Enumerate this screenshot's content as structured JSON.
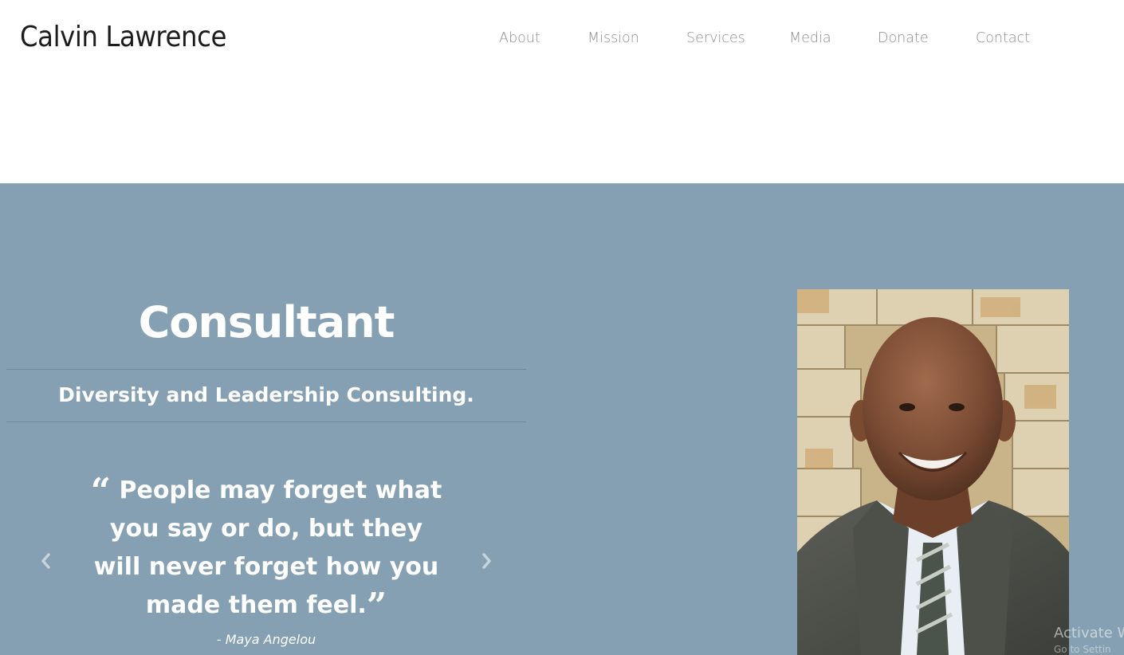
{
  "header": {
    "site_title": "Calvin Lawrence",
    "nav": [
      "About",
      "Mission",
      "Services",
      "Media",
      "Donate",
      "Contact"
    ]
  },
  "hero": {
    "title": "Consultant",
    "subtitle": "Diversity and Leadership Consulting.",
    "quote": {
      "text": "People may forget what you say or do, but they will never forget how you made them feel.",
      "open_mark": "“",
      "close_mark": "”",
      "author": "- Maya Angelou"
    },
    "prev_icon": "chevron-left-icon",
    "next_icon": "chevron-right-icon",
    "portrait_icon": "portrait-photo"
  },
  "watermark": {
    "line1": "Activate W",
    "line2": "Go to Settin"
  },
  "colors": {
    "hero_background": "#84a0b2",
    "nav_text": "#8e8e8e",
    "title_text": "#1c1c1c"
  }
}
